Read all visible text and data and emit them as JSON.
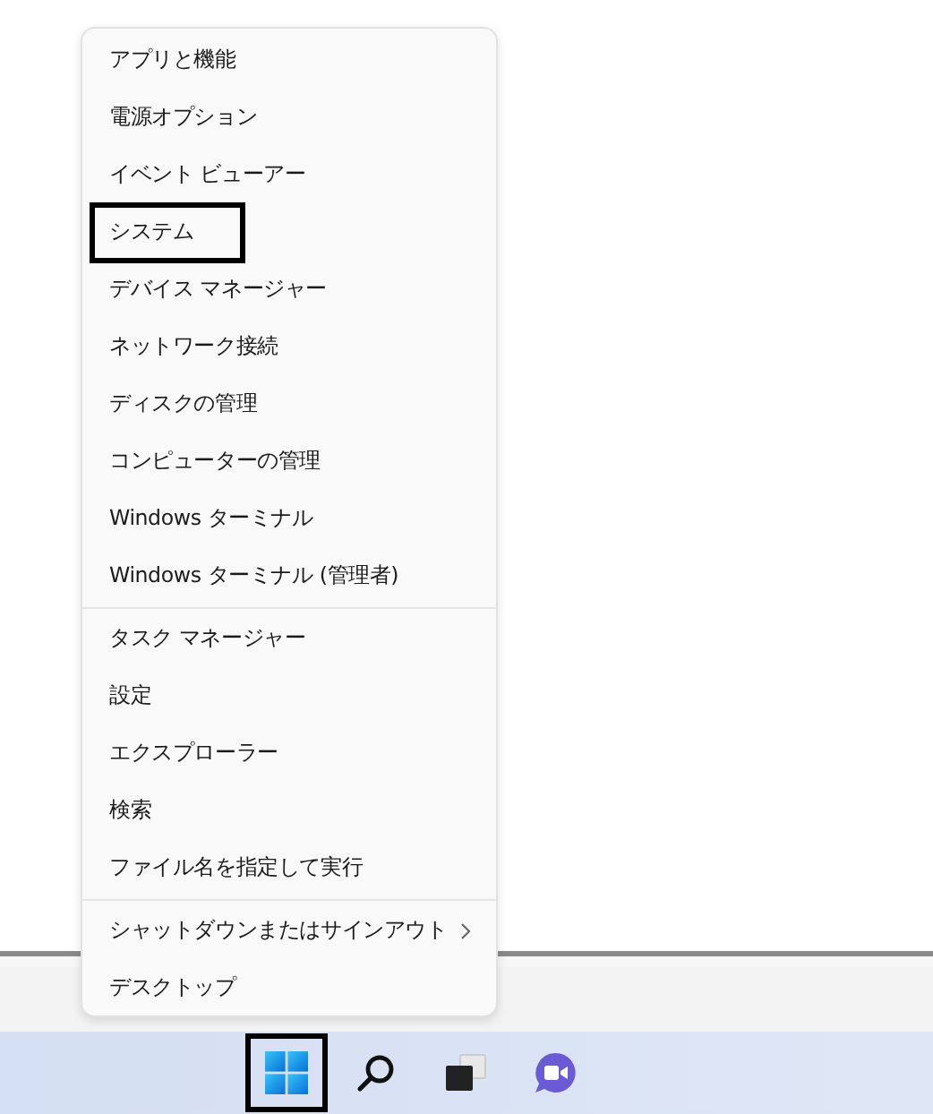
{
  "menu": {
    "groups": [
      [
        {
          "label": "アプリと機能",
          "outlined": false,
          "submenu": false
        },
        {
          "label": "電源オプション",
          "outlined": false,
          "submenu": false
        },
        {
          "label": "イベント ビューアー",
          "outlined": false,
          "submenu": false
        },
        {
          "label": "システム",
          "outlined": true,
          "submenu": false
        },
        {
          "label": "デバイス マネージャー",
          "outlined": false,
          "submenu": false
        },
        {
          "label": "ネットワーク接続",
          "outlined": false,
          "submenu": false
        },
        {
          "label": "ディスクの管理",
          "outlined": false,
          "submenu": false
        },
        {
          "label": "コンピューターの管理",
          "outlined": false,
          "submenu": false
        },
        {
          "label": "Windows ターミナル",
          "outlined": false,
          "submenu": false
        },
        {
          "label": "Windows ターミナル (管理者)",
          "outlined": false,
          "submenu": false
        }
      ],
      [
        {
          "label": "タスク マネージャー",
          "outlined": false,
          "submenu": false
        },
        {
          "label": "設定",
          "outlined": false,
          "submenu": false
        },
        {
          "label": "エクスプローラー",
          "outlined": false,
          "submenu": false
        },
        {
          "label": "検索",
          "outlined": false,
          "submenu": false
        },
        {
          "label": "ファイル名を指定して実行",
          "outlined": false,
          "submenu": false
        }
      ],
      [
        {
          "label": "シャットダウンまたはサインアウト",
          "outlined": false,
          "submenu": true
        },
        {
          "label": "デスクトップ",
          "outlined": false,
          "submenu": false
        }
      ]
    ]
  },
  "taskbar": {
    "icons": [
      {
        "kind": "start",
        "outlined": true
      },
      {
        "kind": "search",
        "outlined": false
      },
      {
        "kind": "taskview",
        "outlined": false
      },
      {
        "kind": "chat",
        "outlined": false
      }
    ]
  }
}
